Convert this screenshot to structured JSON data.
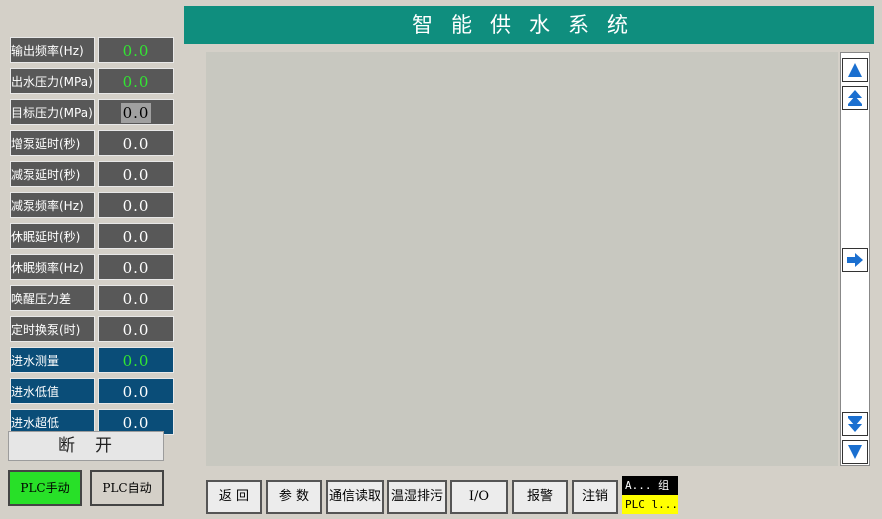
{
  "header": {
    "title": "智能供水系统"
  },
  "params": [
    {
      "label": "输出频率(Hz)",
      "value": "0.0",
      "style": "gray",
      "value_color": "green"
    },
    {
      "label": "出水压力(MPa)",
      "value": "0.0",
      "style": "gray",
      "value_color": "green"
    },
    {
      "label": "目标压力(MPa)",
      "value": "0.0",
      "style": "gray",
      "value_color": "editable"
    },
    {
      "label": "增泵延时(秒)",
      "value": "0.0",
      "style": "gray",
      "value_color": "white"
    },
    {
      "label": "减泵延时(秒)",
      "value": "0.0",
      "style": "gray",
      "value_color": "white"
    },
    {
      "label": "减泵频率(Hz)",
      "value": "0.0",
      "style": "gray",
      "value_color": "white"
    },
    {
      "label": "休眠延时(秒)",
      "value": "0.0",
      "style": "gray",
      "value_color": "white"
    },
    {
      "label": "休眠频率(Hz)",
      "value": "0.0",
      "style": "gray",
      "value_color": "white"
    },
    {
      "label": "唤醒压力差",
      "value": "0.0",
      "style": "gray",
      "value_color": "white"
    },
    {
      "label": "定时换泵(时)",
      "value": "0.0",
      "style": "gray",
      "value_color": "white"
    },
    {
      "label": "进水测量",
      "value": "0.0",
      "style": "blue",
      "value_color": "green"
    },
    {
      "label": "进水低值",
      "value": "0.0",
      "style": "blue",
      "value_color": "white"
    },
    {
      "label": "进水超低",
      "value": "0.0",
      "style": "blue",
      "value_color": "white"
    }
  ],
  "status": {
    "connection": "断开"
  },
  "mode": {
    "manual_label": "PLC手动",
    "auto_label": "PLC自动"
  },
  "scroll_icons": [
    "arrow-up-icon",
    "double-arrow-up-icon",
    "arrow-right-icon",
    "double-arrow-down-icon",
    "arrow-down-icon"
  ],
  "toolbar": {
    "back": "返 回",
    "params": "参 数",
    "comm_read": "通信读取",
    "sewage": "温湿排污",
    "io": "I/O",
    "alarm": "报警",
    "logout": "注销"
  },
  "alarm_indicator": {
    "top": "A... 组",
    "bottom": "PLC l..."
  },
  "colors": {
    "title_bg": "#0f8e7e",
    "param_gray": "#585858",
    "param_blue": "#0a4d78",
    "value_green": "#32e632",
    "manual_active": "#28e028",
    "scroll_arrow": "#1a6fd0"
  }
}
